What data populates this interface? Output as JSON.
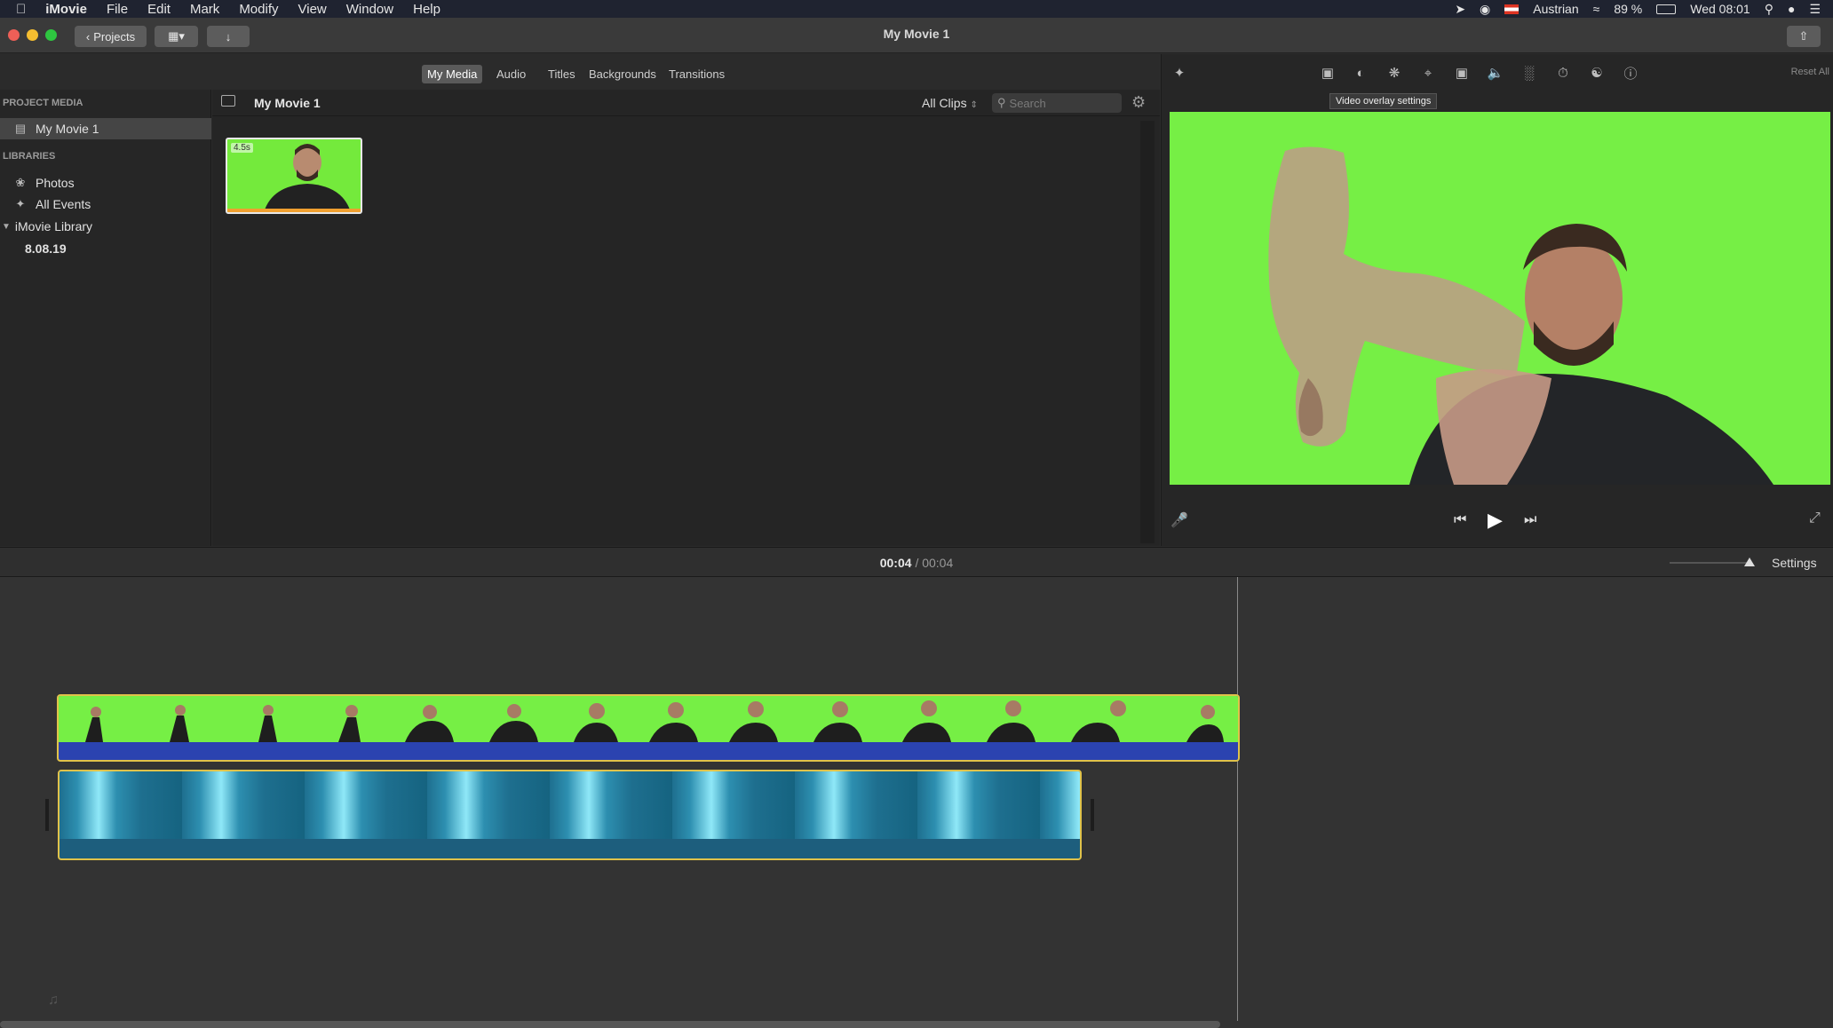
{
  "menubar": {
    "app": "iMovie",
    "items": [
      "File",
      "Edit",
      "Mark",
      "Modify",
      "View",
      "Window",
      "Help"
    ],
    "status": {
      "keyboard": "Austrian",
      "battery": "89 %",
      "clock": "Wed 08:01"
    }
  },
  "toolbar": {
    "projects_label": "Projects",
    "window_title": "My Movie 1"
  },
  "browser": {
    "tabs": [
      "My Media",
      "Audio",
      "Titles",
      "Backgrounds",
      "Transitions"
    ],
    "active_tab": "My Media"
  },
  "sidebar": {
    "project_media_header": "PROJECT MEDIA",
    "project_item": "My Movie 1",
    "libraries_header": "LIBRARIES",
    "photos": "Photos",
    "all_events": "All Events",
    "library": "iMovie Library",
    "event": "8.08.19"
  },
  "content": {
    "title": "My Movie 1",
    "filter": "All Clips",
    "search_placeholder": "Search",
    "clip_duration": "4.5s"
  },
  "viewer": {
    "tooltip": "Video overlay settings",
    "reset_all": "Reset All"
  },
  "timeline": {
    "current": "00:04",
    "separator": "/",
    "total": "00:04",
    "settings": "Settings"
  },
  "colors": {
    "green_screen": "#76ef45",
    "clip_selected_border": "#e0c24a",
    "audio_clip": "#1d5e7d"
  }
}
